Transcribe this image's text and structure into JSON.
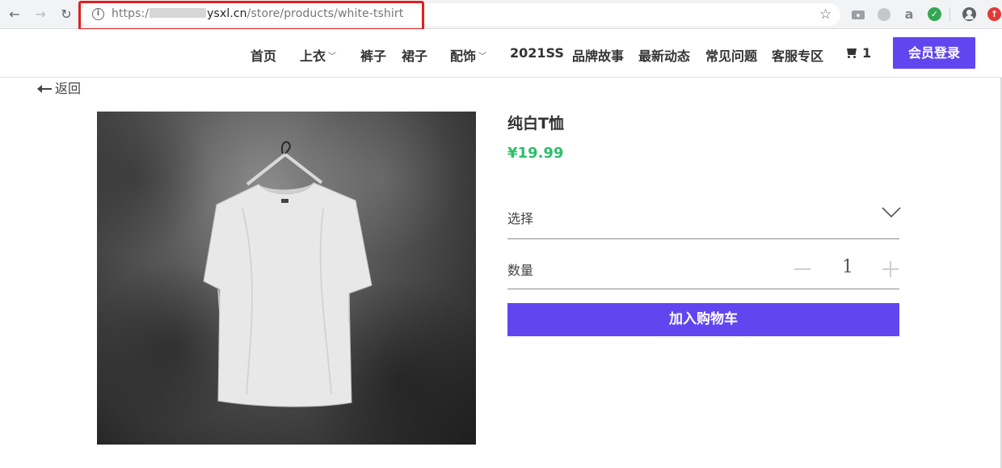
{
  "browser": {
    "url_scheme": "https:/",
    "url_host": "ysxl.cn",
    "url_path": "/store/products/white-tshirt",
    "icons": [
      "back-icon",
      "forward-icon",
      "reload-icon",
      "info-icon",
      "star-icon",
      "camera-icon",
      "leaf-icon",
      "a-icon",
      "v-icon",
      "account-icon",
      "update-icon"
    ]
  },
  "header": {
    "nav": [
      {
        "label": "首页",
        "dropdown": false
      },
      {
        "label": "上衣",
        "dropdown": true
      },
      {
        "label": "裤子",
        "dropdown": false
      },
      {
        "label": "裙子",
        "dropdown": false
      },
      {
        "label": "配饰",
        "dropdown": true
      },
      {
        "label": "2021SS",
        "dropdown": false
      },
      {
        "label": "品牌故事",
        "dropdown": false
      },
      {
        "label": "最新动态",
        "dropdown": false
      },
      {
        "label": "常见问题",
        "dropdown": false
      },
      {
        "label": "客服专区",
        "dropdown": false
      }
    ],
    "cart_count": "1",
    "login_label": "会员登录"
  },
  "page": {
    "back_label": "返回",
    "product": {
      "title": "纯白T恤",
      "price": "¥19.99",
      "select_label": "选择",
      "quantity_label": "数量",
      "quantity": "1",
      "add_to_cart_label": "加入购物车"
    }
  },
  "colors": {
    "accent": "#6146f0",
    "price": "#2ebd6b",
    "highlight_box": "#e02020"
  }
}
